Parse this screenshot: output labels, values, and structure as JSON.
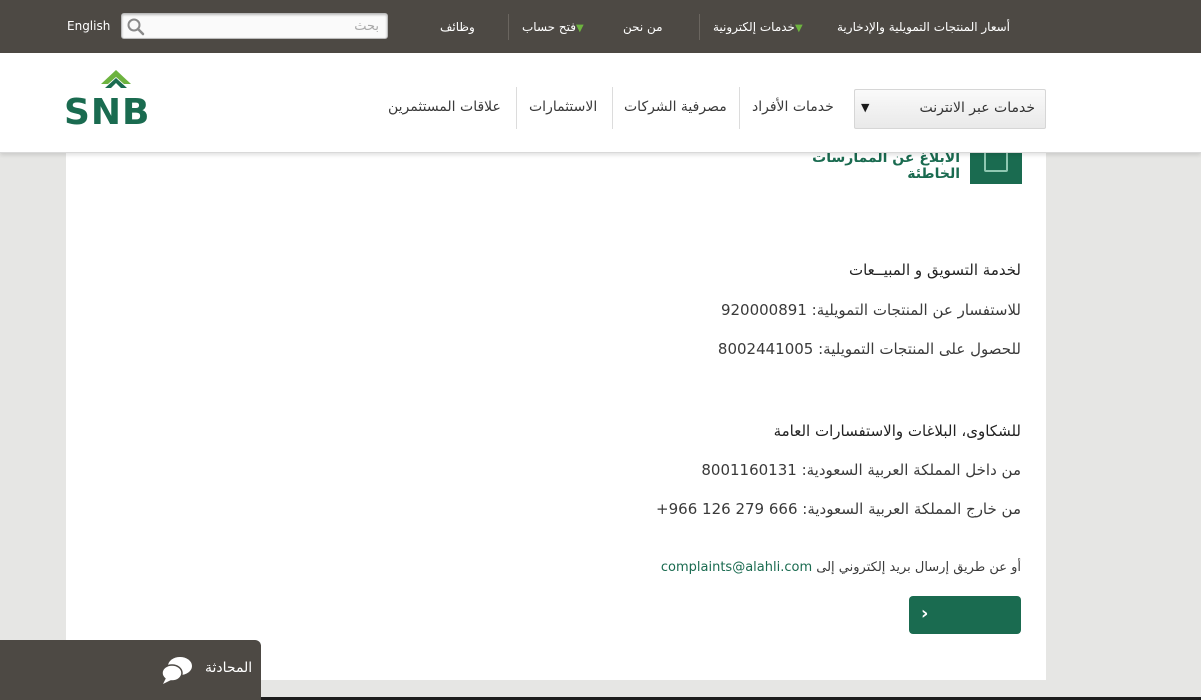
{
  "topbar": {
    "lang_link": "English",
    "search_placeholder": "بحث",
    "links": {
      "jobs": "وظائف",
      "open_account": "فتح حساب",
      "about": "من نحن",
      "e_services": "خدمات إلكترونية",
      "prices": "أسعار المنتجات التمويلية والإدخارية"
    }
  },
  "nav": {
    "logo_text": "SNB",
    "online_services": "خدمات عبر الانترنت",
    "personal": "خدمات الأفراد",
    "corporate": "مصرفية الشركات",
    "investments": "الاستثمارات",
    "investor_relations": "علاقات المستثمرين"
  },
  "content": {
    "card_title": "الابلاغ عن الممارسات الخاطئة",
    "sales_heading": "لخدمة التسويق و المبيــعات",
    "sales_inquiry": "للاستفسار عن المنتجات التمويلية: 920000891",
    "sales_obtain": "للحصول على المنتجات التمويلية: 8002441005",
    "complaints_heading": "للشكاوى، البلاغات والاستفسارات العامة",
    "inside_ksa": "من داخل المملكة العربية السعودية: 8001160131",
    "outside_ksa": "من خارج المملكة العربية السعودية: 666 279 126 966+",
    "email_prefix": "أو عن طريق إرسال بريد إلكتروني إلى",
    "email": "complaints@alahli.com",
    "go_button": "›"
  },
  "chat": {
    "label": "المحادثة"
  },
  "colors": {
    "brand_green": "#1a6b50",
    "topbar_bg": "#4d4944",
    "accent_triangle": "#6db33f"
  }
}
